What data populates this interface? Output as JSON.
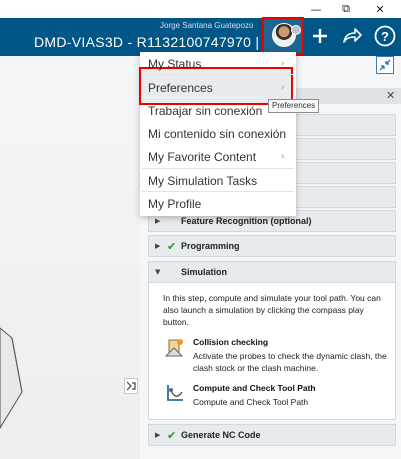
{
  "window": {
    "minimize": "—",
    "maximize": "⧉",
    "close": "✕"
  },
  "header": {
    "username": "Jorge Santana Guatepozo",
    "doc_title": "DMD-VIAS3D - R1132100747970 | ...",
    "icons": [
      "add-icon",
      "share-icon",
      "help-icon"
    ]
  },
  "menu": {
    "items": [
      {
        "label": "My Status",
        "submenu": true
      },
      {
        "label": "Preferences",
        "submenu": true
      },
      {
        "label": "Trabajar sin conexión",
        "submenu": false
      },
      {
        "label": "Mi contenido sin conexión",
        "submenu": false
      },
      {
        "label": "My Favorite Content",
        "submenu": true
      },
      {
        "label": "My Simulation Tasks",
        "submenu": false
      },
      {
        "label": "My Profile",
        "submenu": false
      }
    ],
    "tooltip": "Preferences"
  },
  "panel": {
    "steps": [
      {
        "label": "Feature Recognition (optional)",
        "expanded": false,
        "done": false
      },
      {
        "label": "Programming",
        "expanded": false,
        "done": true
      },
      {
        "label": "Simulation",
        "expanded": true,
        "done": false
      },
      {
        "label": "Generate NC Code",
        "expanded": false,
        "done": true
      }
    ],
    "simulation": {
      "intro": "In this step, compute and simulate your tool path. You can also launch a simulation by clicking the compass play button.",
      "collision_title": "Collision checking",
      "collision_desc": "Activate the probes to check the dynamic clash, the clash stock or the clash machine.",
      "compute_title": "Compute and Check Tool Path",
      "compute_desc": "Compute and Check Tool Path"
    }
  },
  "colors": {
    "header": "#005686",
    "highlight": "#e00000",
    "check": "#1a9c2a"
  }
}
